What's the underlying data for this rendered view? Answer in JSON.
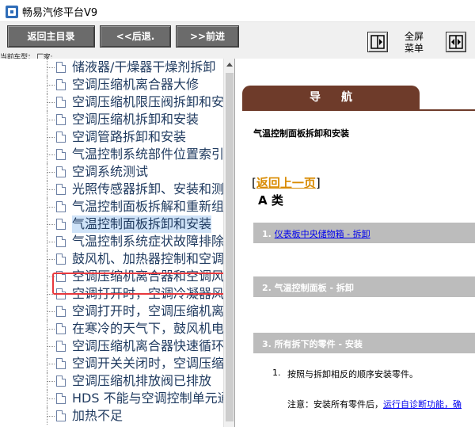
{
  "window": {
    "title": "畅易汽修平台V9"
  },
  "toolbar": {
    "home_label": "返回主目录",
    "back_label": "<<后退.",
    "forward_label": ">>前进",
    "fullscreen_label": "全屏\n菜单",
    "car_info": "当前车型： 厂家:",
    "left_icon": "collapse-left-icon",
    "right_icon": "expand-panels-icon"
  },
  "tree": {
    "items": [
      {
        "label": "储液器/干燥器干燥剂拆卸"
      },
      {
        "label": "空调压缩机离合器大修"
      },
      {
        "label": "空调压缩机限压阀拆卸和安装"
      },
      {
        "label": "空调压缩机拆卸和安装"
      },
      {
        "label": "空调管路拆卸和安装"
      },
      {
        "label": "气温控制系统部件位置索引"
      },
      {
        "label": "空调系统测试"
      },
      {
        "label": "光照传感器拆卸、安装和测试"
      },
      {
        "label": "气温控制面板拆解和重新组装"
      },
      {
        "label": "气温控制面板拆卸和安装",
        "selected": true
      },
      {
        "label": "气温控制系统症状故障排除"
      },
      {
        "label": "鼓风机、加热器控制和空调"
      },
      {
        "label": "空调压缩机离合器和空调风扇"
      },
      {
        "label": "空调打开时，空调冷凝器风扇"
      },
      {
        "label": "空调打开时，空调压缩机离合器"
      },
      {
        "label": "在寒冷的天气下，鼓风机电机"
      },
      {
        "label": "空调压缩机离合器快速循环"
      },
      {
        "label": "空调开关关闭时，空调压缩机"
      },
      {
        "label": "空调压缩机排放阀已排放"
      },
      {
        "label": "HDS 不能与空调控制单元通信"
      },
      {
        "label": "加热不足"
      }
    ]
  },
  "content": {
    "nav_tab": "导航",
    "page_title": "气温控制面板拆卸和安装",
    "back_bracket_open": "[",
    "back_link": "返回上一页",
    "back_bracket_close": "]",
    "class_label": "A 类",
    "steps": [
      {
        "prefix": "1. ",
        "link": "仪表板中央储物箱 - 拆卸",
        "text": ""
      },
      {
        "prefix": "2. ",
        "link": "",
        "text": "气温控制面板 - 拆卸"
      },
      {
        "prefix": "3. ",
        "link": "",
        "text": "所有拆下的零件 - 安装"
      }
    ],
    "instruction_num": "1.",
    "instruction_text": "按照与拆卸相反的顺序安装零件。",
    "note_prefix": "注意：安装所有零件后，",
    "note_link": "运行自诊断功能，确"
  },
  "colors": {
    "toolbar_button": "#6b6b6b",
    "nav_tab": "#6e3b2a",
    "step_bar": "#bcbcbc",
    "back_link": "#d98b00",
    "hyperlink": "#0000ee",
    "selection_border": "#e8383d"
  }
}
